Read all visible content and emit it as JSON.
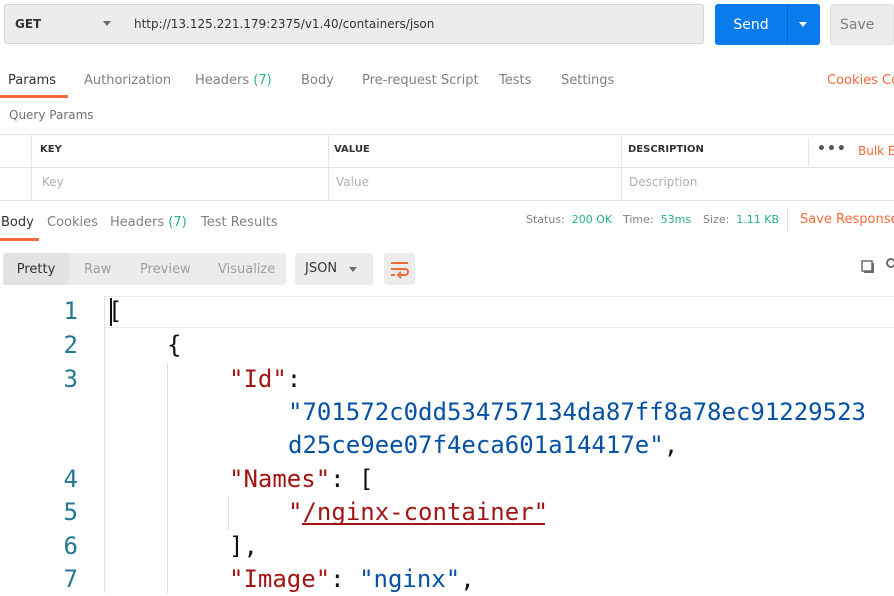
{
  "request": {
    "method": "GET",
    "url": "http://13.125.221.179:2375/v1.40/containers/json",
    "send_label": "Send",
    "save_label": "Save"
  },
  "request_tabs": [
    {
      "label": "Params",
      "active": true
    },
    {
      "label": "Authorization"
    },
    {
      "label": "Headers",
      "count": "(7)"
    },
    {
      "label": "Body"
    },
    {
      "label": "Pre-request Script"
    },
    {
      "label": "Tests"
    },
    {
      "label": "Settings"
    }
  ],
  "cookies_link": "Cookies",
  "code_link": "Co",
  "query_params": {
    "title": "Query Params",
    "headers": [
      "KEY",
      "VALUE",
      "DESCRIPTION"
    ],
    "placeholders": [
      "Key",
      "Value",
      "Description"
    ],
    "more": "•••",
    "bulk_edit": "Bulk E"
  },
  "response_tabs": [
    {
      "label": "Body",
      "active": true
    },
    {
      "label": "Cookies"
    },
    {
      "label": "Headers",
      "count": "(7)"
    },
    {
      "label": "Test Results"
    }
  ],
  "response_meta": {
    "status_label": "Status:",
    "status_value": "200 OK",
    "time_label": "Time:",
    "time_value": "53ms",
    "size_label": "Size:",
    "size_value": "1.11 KB",
    "save_response": "Save Response"
  },
  "viewer": {
    "modes": [
      "Pretty",
      "Raw",
      "Preview",
      "Visualize"
    ],
    "active_mode": "Pretty",
    "format": "JSON"
  },
  "colors": {
    "accent": "#f26b3a",
    "send": "#097bed",
    "ok": "#26b47f",
    "json_key": "#a31515",
    "json_string": "#0451a5",
    "line_number": "#237893"
  },
  "code": {
    "line_numbers": [
      "1",
      "2",
      "3",
      "4",
      "5",
      "6",
      "7"
    ],
    "l1": "[",
    "l2": "{",
    "l3_key": "\"Id\"",
    "l3_colon": ":",
    "l3_val_a": "\"701572c0dd534757134da87ff8a78ec91229523",
    "l3_val_b": "d25ce9ee07f4eca601a14417e\"",
    "l3_comma": ",",
    "l4_key": "\"Names\"",
    "l4_rest": ": [",
    "l5_val": "\"/nginx-container\"",
    "l6": "],",
    "l7_key": "\"Image\"",
    "l7_colon": ": ",
    "l7_val": "\"nginx\"",
    "l7_comma": ","
  }
}
